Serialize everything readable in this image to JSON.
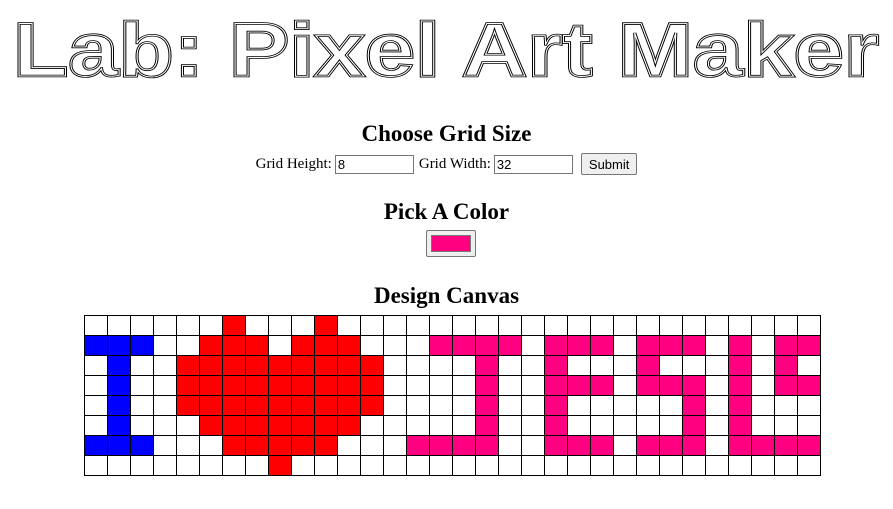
{
  "title": "Lab: Pixel Art Maker",
  "grid_section": {
    "heading": "Choose Grid Size",
    "height_label": "Grid Height:",
    "height_value": "8",
    "width_label": "Grid Width:",
    "width_value": "32",
    "submit_label": "Submit"
  },
  "color_section": {
    "heading": "Pick A Color",
    "selected_color": "#ff0080"
  },
  "canvas_section": {
    "heading": "Design Canvas",
    "rows": 8,
    "cols": 32,
    "palette": {
      "B": "#0000ff",
      "R": "#ff0000",
      "P": "#ff0080",
      ".": "#ffffff"
    },
    "pixels": [
      "......R...R.....................",
      "BBB..RRR.RRR...PPPP.PPP.PPP.P.PP",
      ".B..RRRRRRRRR....P..P...P...P.P.",
      ".B..RRRRRRRRR....P..PPP.PPP.P.PP",
      ".B..RRRRRRRRR....P..P.....P.P...",
      ".B...RRRRRRR.....P..P.....P.P...",
      "BBB...RRRRR...PPPP..PPP.PPP.PPPP",
      "........R......................."
    ]
  }
}
